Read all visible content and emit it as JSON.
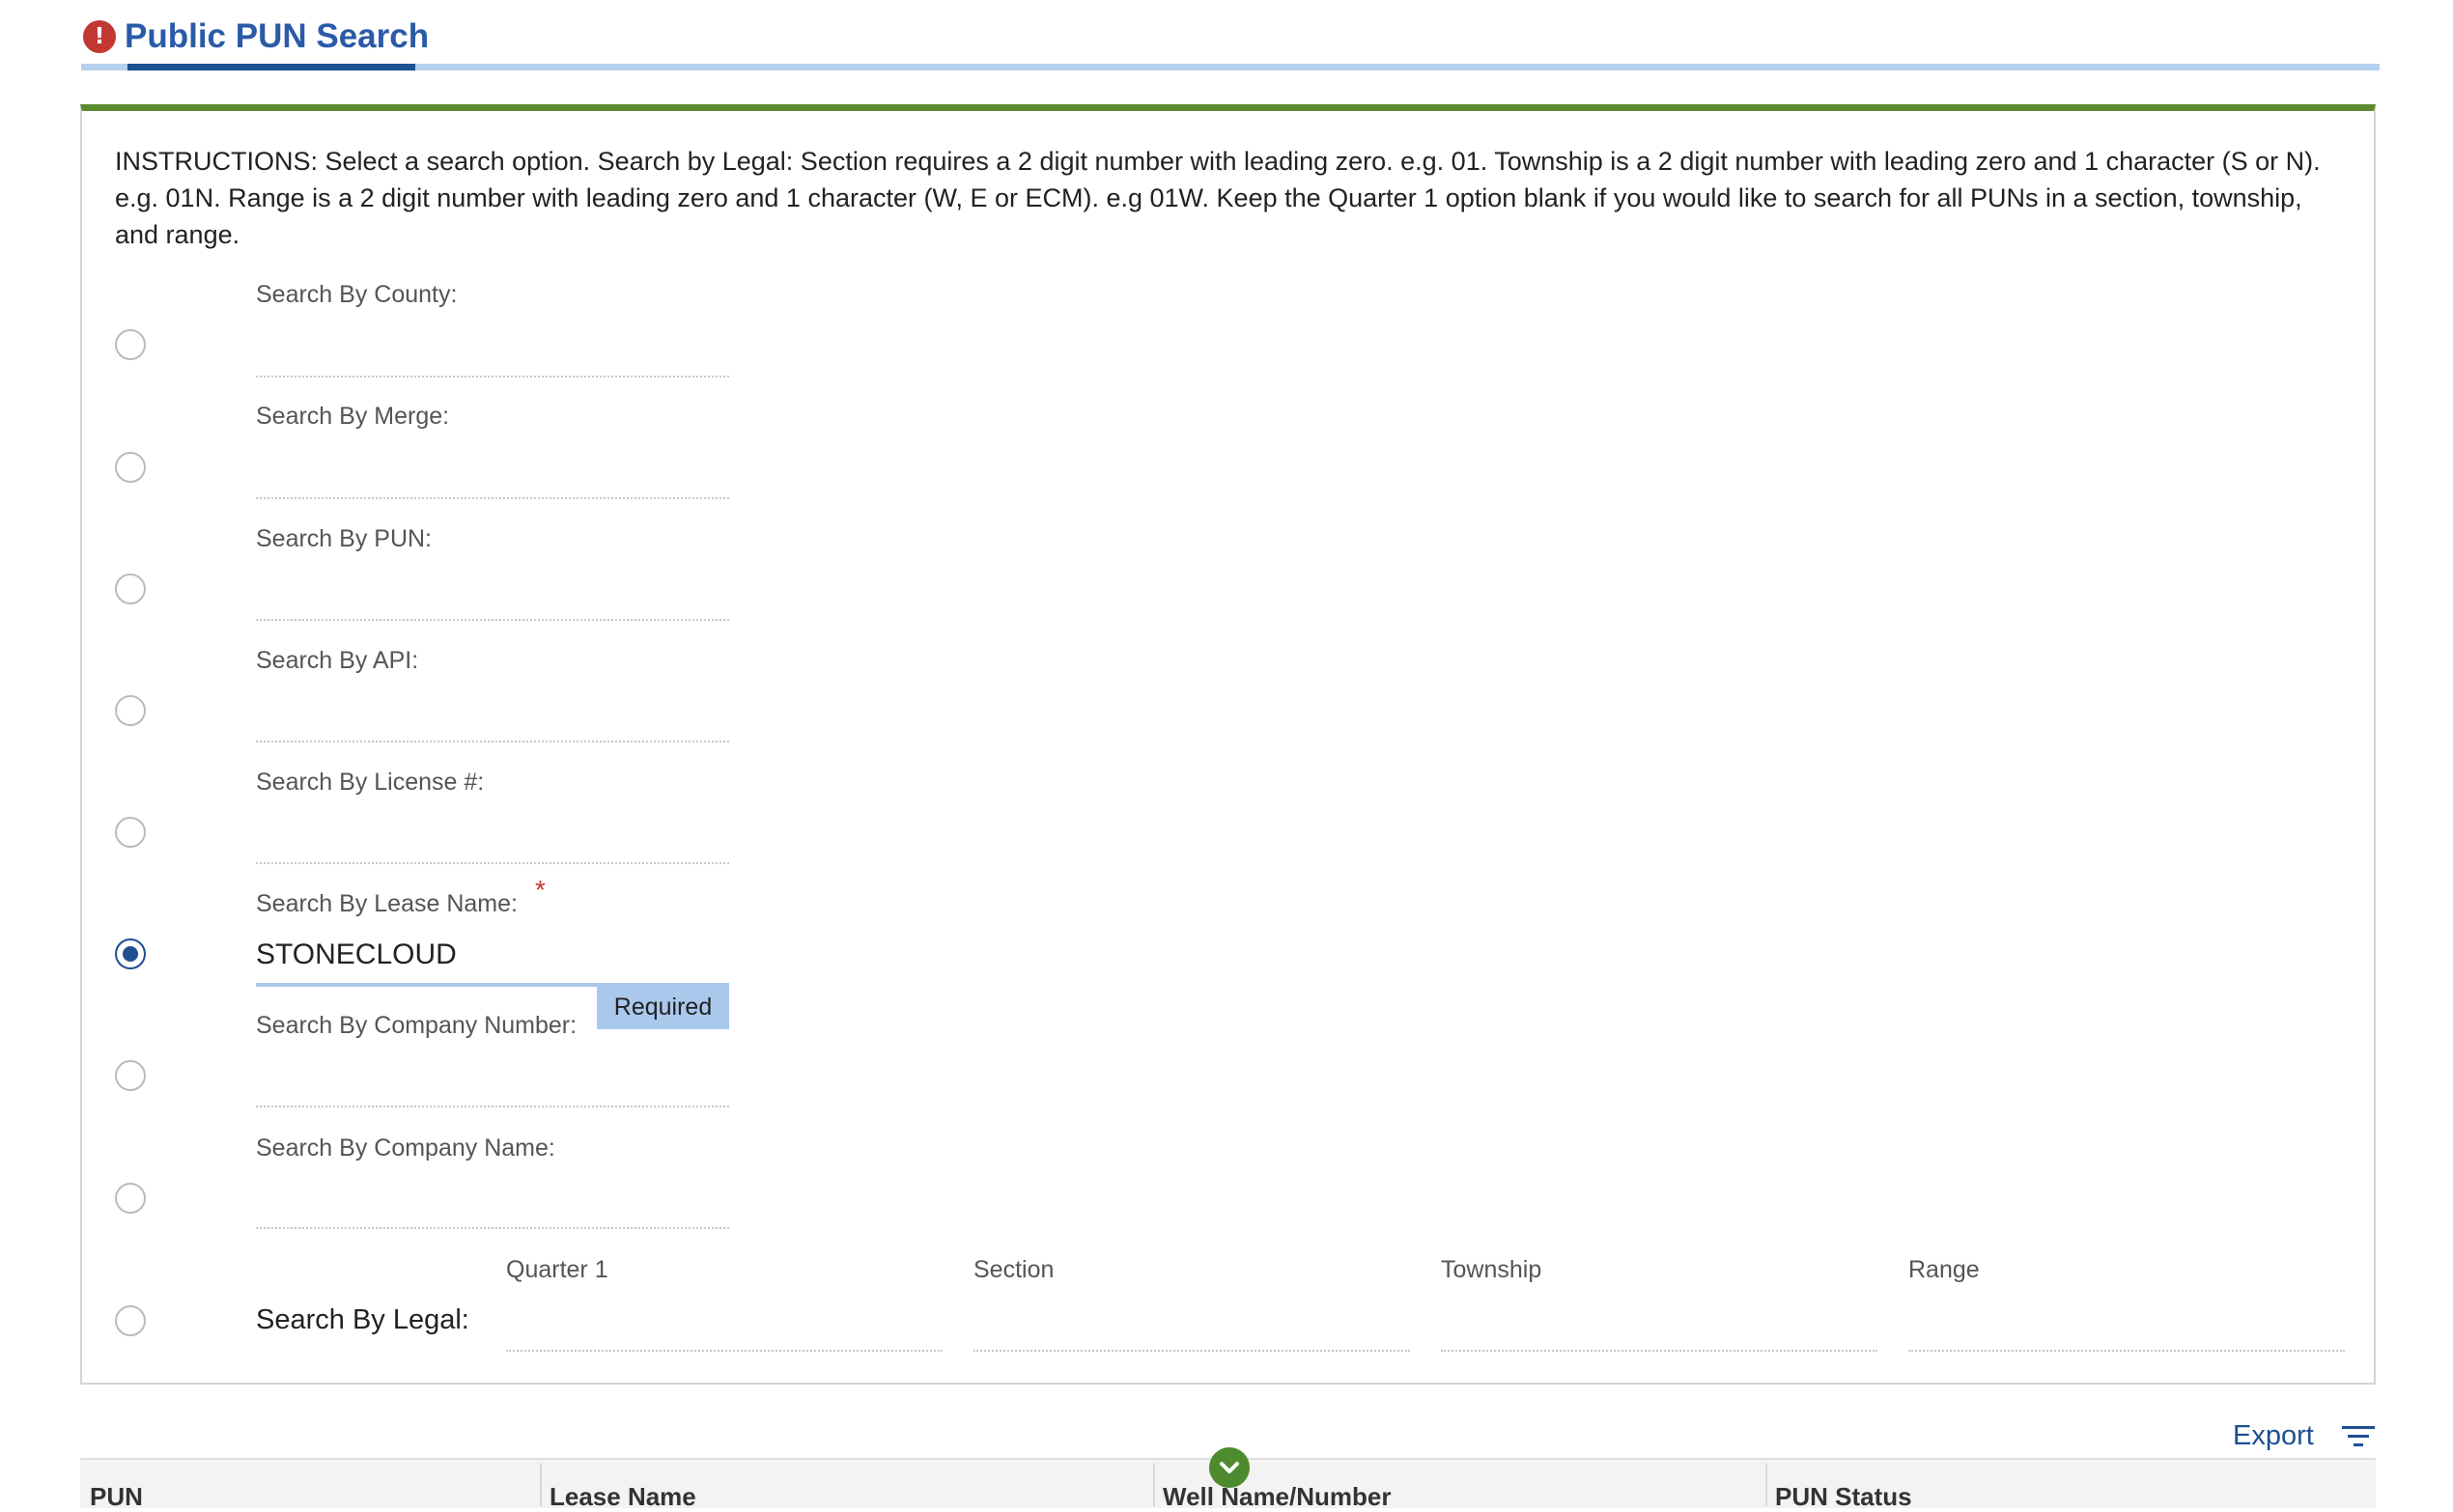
{
  "header": {
    "title": "Public PUN Search",
    "alert_icon": "exclamation-circle-icon",
    "alert_glyph": "!"
  },
  "instructions": "INSTRUCTIONS: Select a search option. Search by Legal: Section requires a 2 digit number with leading zero. e.g. 01. Township is a 2 digit number with leading zero and 1 character (S or N). e.g. 01N. Range is a 2 digit number with leading zero and 1 character (W, E or ECM). e.g 01W. Keep the Quarter 1 option blank if you would like to search for all PUNs in a section, township, and range.",
  "search_options": {
    "county": {
      "label": "Search By County:",
      "value": ""
    },
    "merge": {
      "label": "Search By Merge:",
      "value": ""
    },
    "pun": {
      "label": "Search By PUN:",
      "value": ""
    },
    "api": {
      "label": "Search By API:",
      "value": ""
    },
    "license": {
      "label": "Search By License #:",
      "value": ""
    },
    "lease_name": {
      "label": "Search By Lease Name:",
      "value": "STONECLOUD",
      "required_marker": "*",
      "required_badge": "Required",
      "selected": true
    },
    "company_number": {
      "label": "Search By Company Number:",
      "value": ""
    },
    "company_name": {
      "label": "Search By Company Name:",
      "value": ""
    }
  },
  "legal": {
    "label": "Search By Legal:",
    "fields": {
      "quarter1": "Quarter 1",
      "section": "Section",
      "township": "Township",
      "range": "Range"
    }
  },
  "toolbar": {
    "export_label": "Export",
    "filter_icon": "filter-icon"
  },
  "table": {
    "columns": [
      "PUN",
      "Lease Name",
      "Well Name/Number",
      "PUN Status"
    ]
  },
  "colors": {
    "brand_blue": "#1d4f91",
    "accent_green": "#5b8a2e",
    "error_red": "#c23934",
    "light_blue": "#a9c8ec"
  }
}
